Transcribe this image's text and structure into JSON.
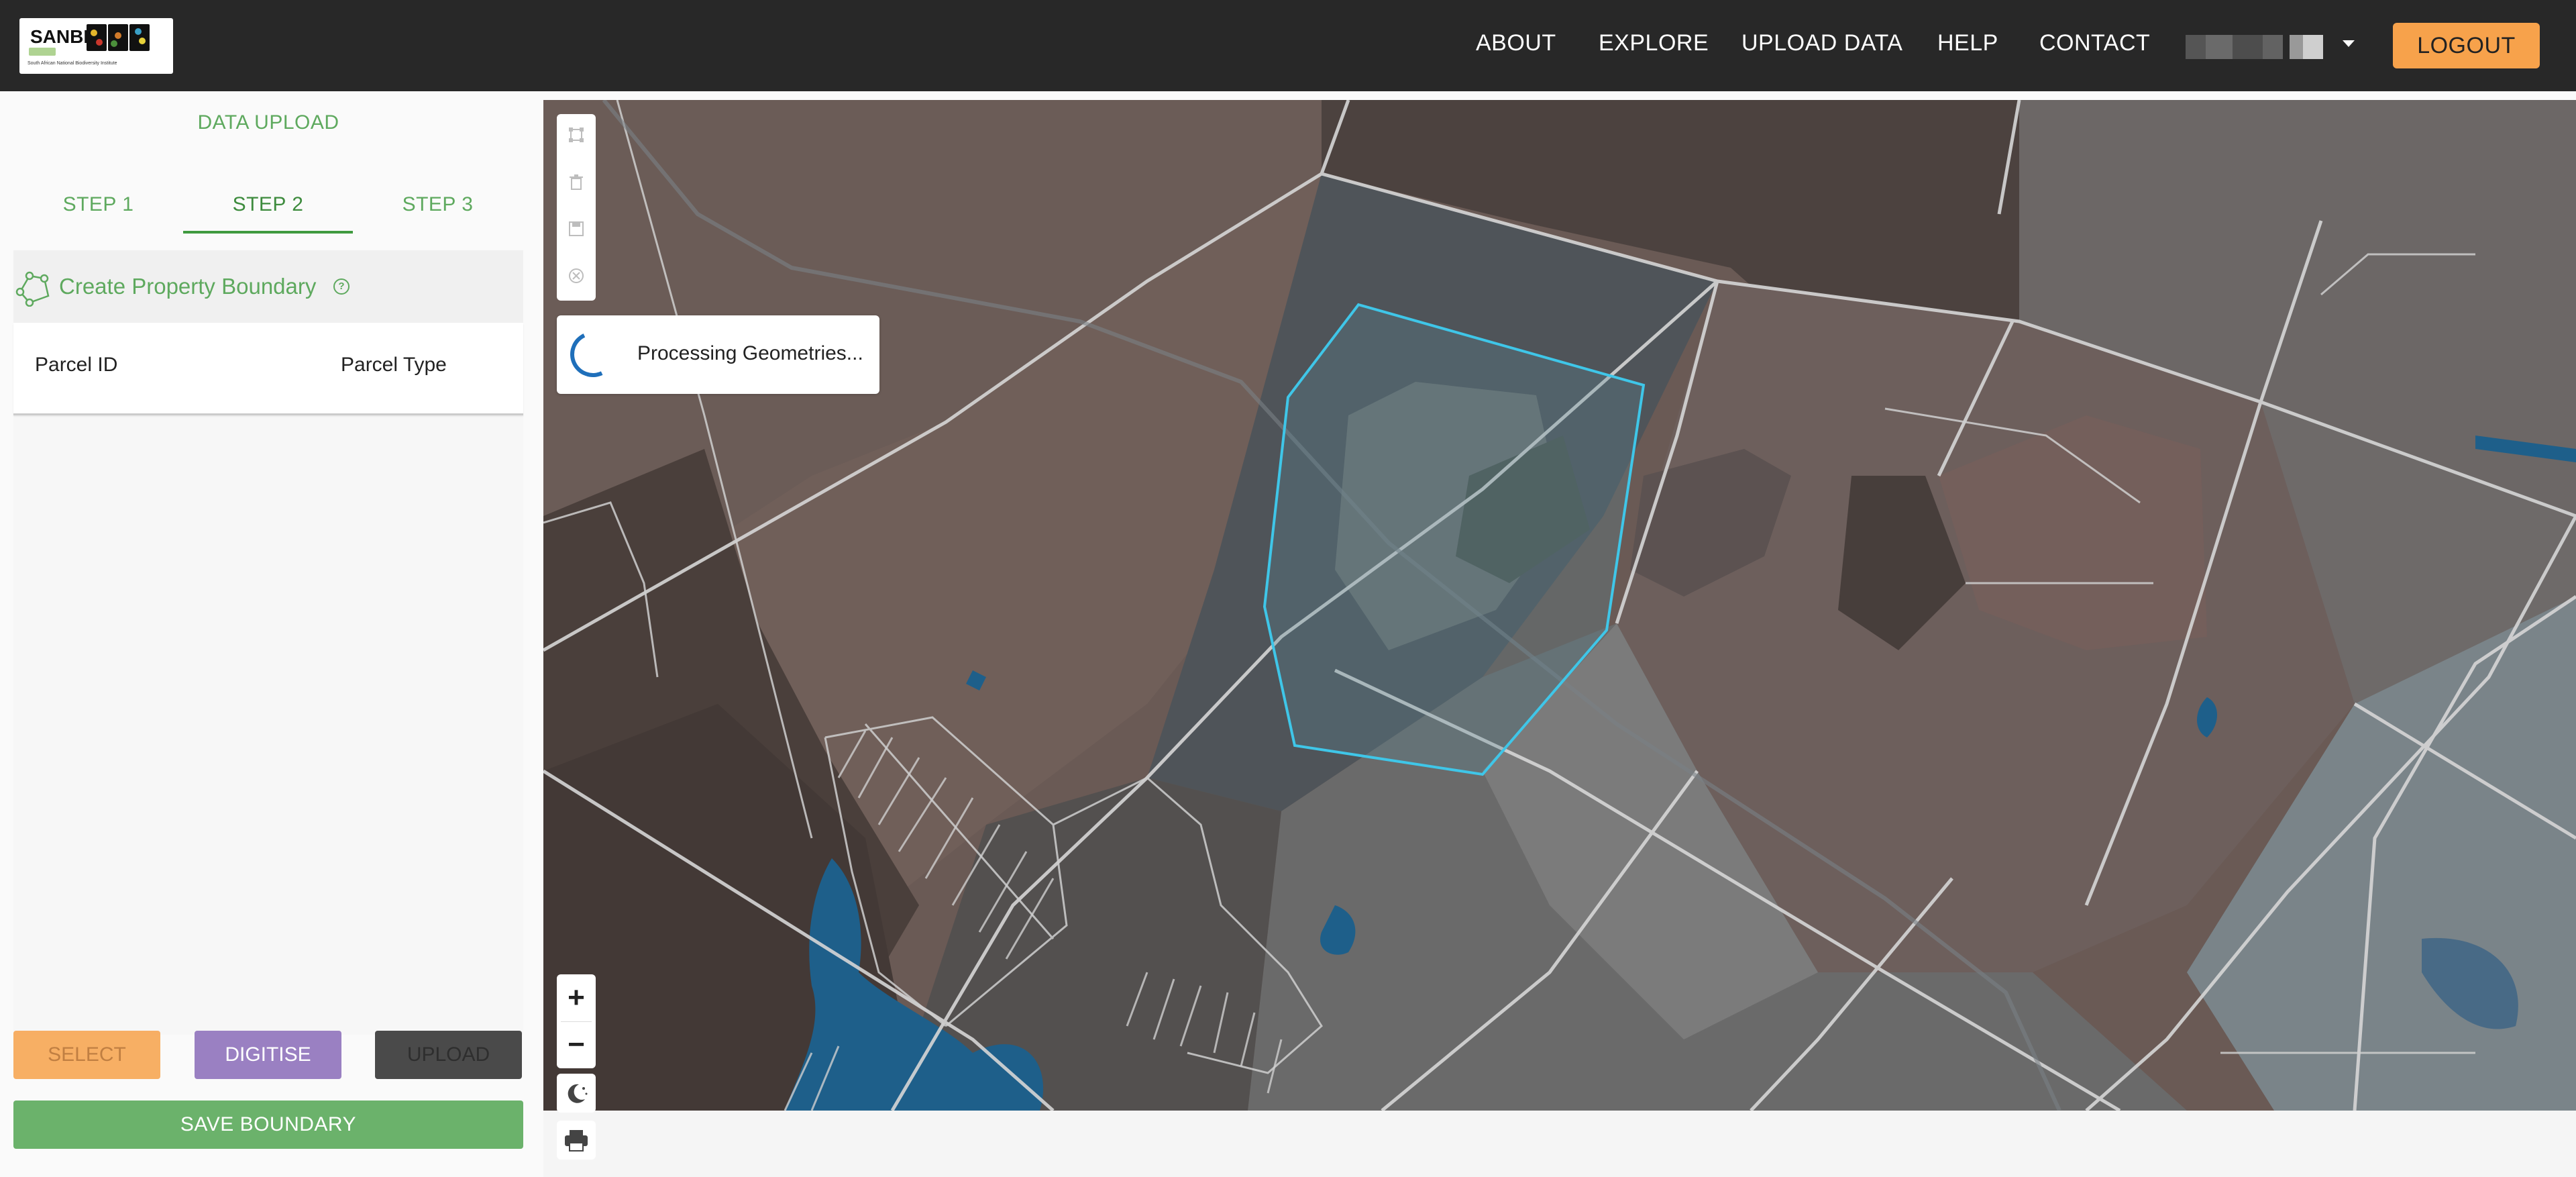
{
  "brand": {
    "logo_text": "SANBI",
    "logo_subtitle": "South African National Biodiversity Institute"
  },
  "nav": {
    "items": [
      {
        "label": "ABOUT"
      },
      {
        "label": "EXPLORE"
      },
      {
        "label": "UPLOAD DATA"
      },
      {
        "label": "HELP"
      },
      {
        "label": "CONTACT"
      }
    ],
    "logout_label": "LOGOUT"
  },
  "panel": {
    "title": "DATA UPLOAD",
    "tabs": [
      {
        "label": "STEP 1",
        "active": false
      },
      {
        "label": "STEP 2",
        "active": true
      },
      {
        "label": "STEP 3",
        "active": false
      }
    ],
    "boundary_label": "Create Property Boundary",
    "columns": [
      "Parcel ID",
      "Parcel Type"
    ],
    "buttons": {
      "select": "SELECT",
      "digitise": "DIGITISE",
      "upload": "UPLOAD",
      "save": "SAVE BOUNDARY"
    }
  },
  "map": {
    "status_message": "Processing Geometries...",
    "zoom_in": "+",
    "zoom_out": "−",
    "toolbar_icons": [
      "draw-rectangle-icon",
      "trash-icon",
      "save-icon",
      "cancel-icon"
    ],
    "colors": {
      "boundary": "#3fc6e8",
      "water": "#1e5f8a",
      "accent_orange": "#f7a24b",
      "accent_green": "#5ea95e",
      "accent_purple": "#9a80c2"
    }
  }
}
